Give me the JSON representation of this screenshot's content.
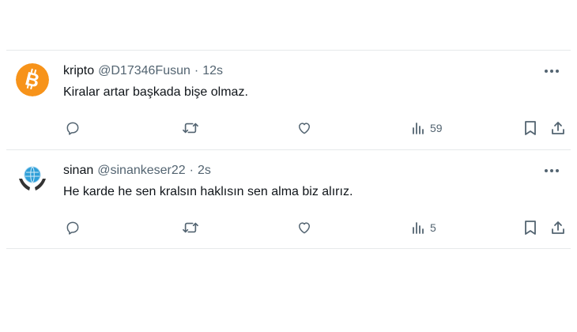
{
  "tweets": [
    {
      "author_name": "kripto",
      "handle": "@D17346Fusun",
      "separator": "·",
      "time": "12s",
      "text": "Kiralar artar başkada bişe olmaz.",
      "avatar": "bitcoin-logo",
      "avatar_color": "#f7931a",
      "views": "59"
    },
    {
      "author_name": "sinan",
      "handle": "@sinankeser22",
      "separator": "·",
      "time": "2s",
      "text": "He karde he sen kralsın haklısın sen alma biz alırız.",
      "avatar": "hands-globe-logo",
      "avatar_color": "#2f9fd8",
      "views": "5"
    }
  ],
  "icons": {
    "reply": "reply-icon",
    "retweet": "retweet-icon",
    "like": "heart-icon",
    "views": "views-chart-icon",
    "bookmark": "bookmark-icon",
    "share": "share-icon",
    "more": "more-icon"
  },
  "colors": {
    "text": "#0f1419",
    "secondary": "#536471",
    "divider": "#e6e9eb"
  }
}
